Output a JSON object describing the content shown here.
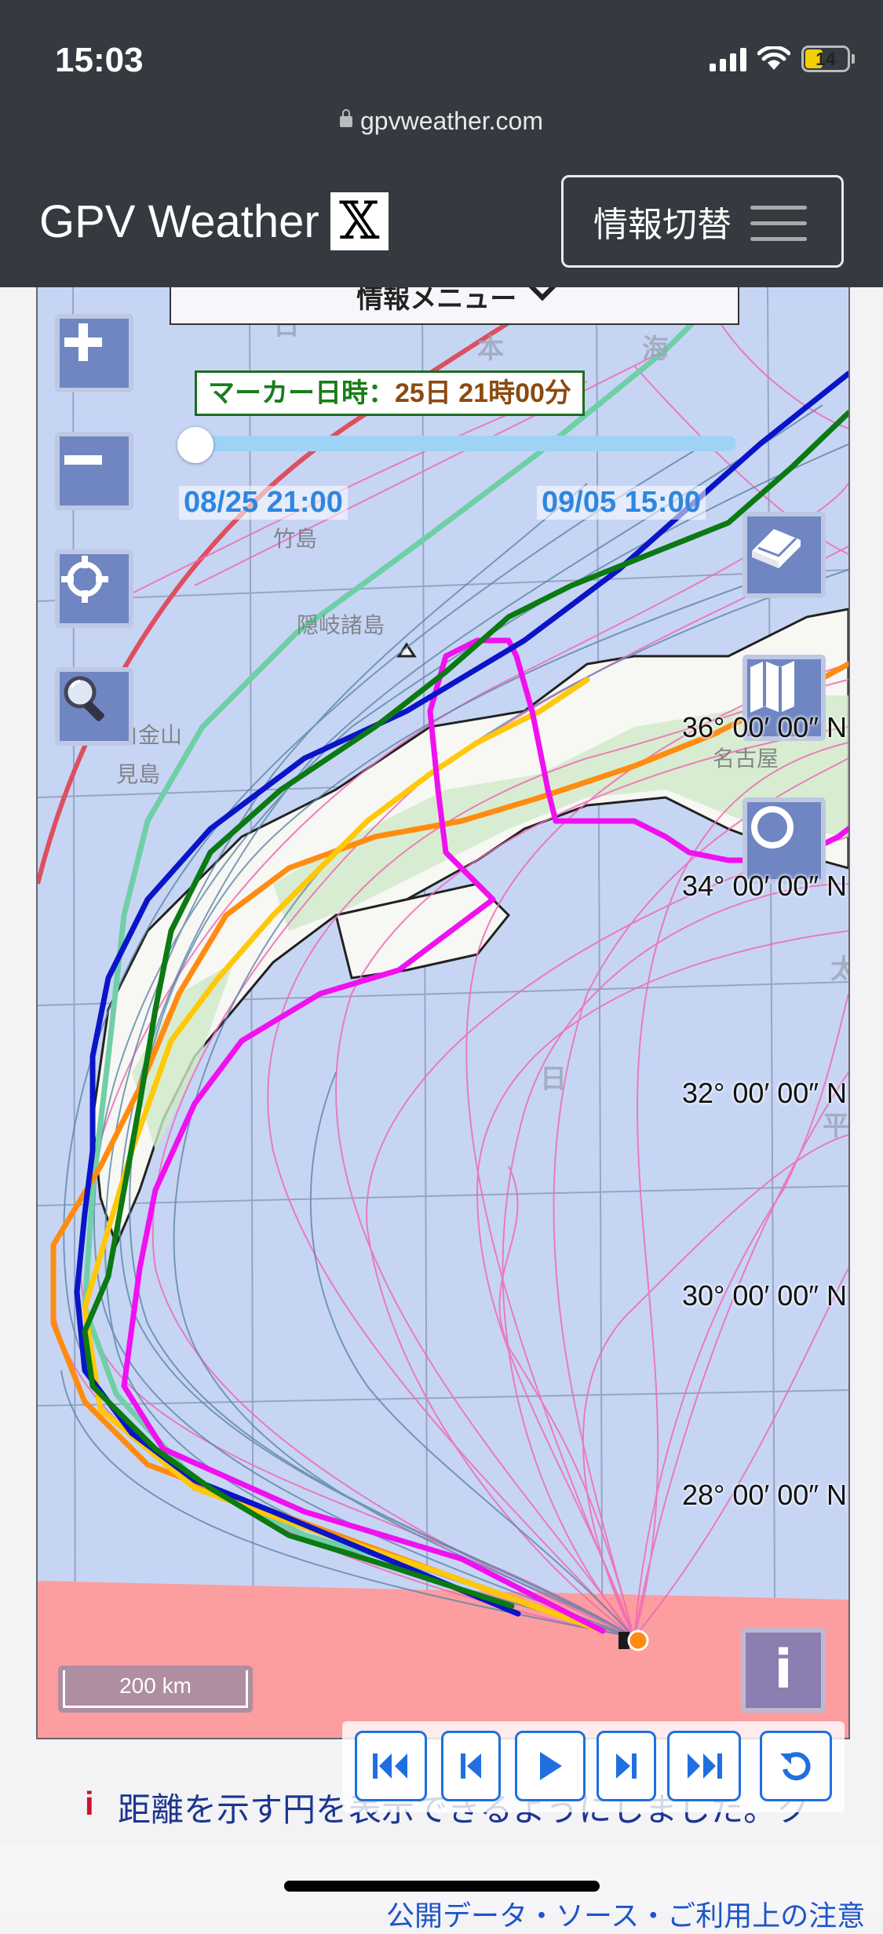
{
  "status_bar": {
    "time": "15:03",
    "battery": "14"
  },
  "browser": {
    "url": "gpvweather.com"
  },
  "header": {
    "brand": "GPV Weather",
    "logo_glyph": "𝕏",
    "menu_toggle_label": "情報切替"
  },
  "map": {
    "info_menu_label": "情報メニュー",
    "marker": {
      "label": "マーカー日時：",
      "value": "25日 21時00分"
    },
    "time_slider": {
      "start": "08/25 21:00",
      "end": "09/05 15:00",
      "position": 0
    },
    "latitude_labels": [
      "36° 00′ 00″ N",
      "34° 00′ 00″ N",
      "32° 00′ 00″ N",
      "30° 00′ 00″ N",
      "28° 00′ 00″ N"
    ],
    "scale_label": "200 km",
    "info_button_label": "i",
    "map_labels": [
      "竹島",
      "隠岐諸島",
      "白金山",
      "見島",
      "名古屋"
    ],
    "track_colors": {
      "ensemble_pink": "#f06bb5",
      "ensemble_blue": "#5e86a8",
      "dark_blue": "#0a14c8",
      "green": "#0b7a12",
      "aqua": "#6fcfa6",
      "orange": "#ff8c10",
      "yellow": "#ffc808",
      "magenta": "#f010f0",
      "red": "#dc5060",
      "warning_zone": "#ff9a9a"
    }
  },
  "playback": {
    "buttons": [
      "first-icon",
      "previous-icon",
      "play-icon",
      "next-icon",
      "last-icon",
      "reload-icon"
    ]
  },
  "notice": {
    "icon": "i",
    "text": "距離を示す円を表示できるようにしました。ク"
  },
  "footer": {
    "link": "公開データ・ソース・ご利用上の注意"
  }
}
